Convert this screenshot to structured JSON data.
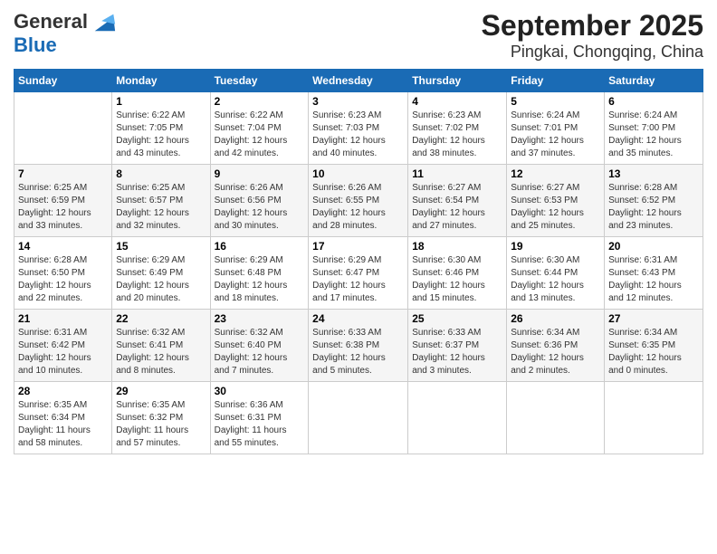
{
  "header": {
    "logo_general": "General",
    "logo_blue": "Blue",
    "title": "September 2025",
    "subtitle": "Pingkai, Chongqing, China"
  },
  "columns": [
    "Sunday",
    "Monday",
    "Tuesday",
    "Wednesday",
    "Thursday",
    "Friday",
    "Saturday"
  ],
  "weeks": [
    [
      {
        "day": "",
        "detail": ""
      },
      {
        "day": "1",
        "detail": "Sunrise: 6:22 AM\nSunset: 7:05 PM\nDaylight: 12 hours\nand 43 minutes."
      },
      {
        "day": "2",
        "detail": "Sunrise: 6:22 AM\nSunset: 7:04 PM\nDaylight: 12 hours\nand 42 minutes."
      },
      {
        "day": "3",
        "detail": "Sunrise: 6:23 AM\nSunset: 7:03 PM\nDaylight: 12 hours\nand 40 minutes."
      },
      {
        "day": "4",
        "detail": "Sunrise: 6:23 AM\nSunset: 7:02 PM\nDaylight: 12 hours\nand 38 minutes."
      },
      {
        "day": "5",
        "detail": "Sunrise: 6:24 AM\nSunset: 7:01 PM\nDaylight: 12 hours\nand 37 minutes."
      },
      {
        "day": "6",
        "detail": "Sunrise: 6:24 AM\nSunset: 7:00 PM\nDaylight: 12 hours\nand 35 minutes."
      }
    ],
    [
      {
        "day": "7",
        "detail": "Sunrise: 6:25 AM\nSunset: 6:59 PM\nDaylight: 12 hours\nand 33 minutes."
      },
      {
        "day": "8",
        "detail": "Sunrise: 6:25 AM\nSunset: 6:57 PM\nDaylight: 12 hours\nand 32 minutes."
      },
      {
        "day": "9",
        "detail": "Sunrise: 6:26 AM\nSunset: 6:56 PM\nDaylight: 12 hours\nand 30 minutes."
      },
      {
        "day": "10",
        "detail": "Sunrise: 6:26 AM\nSunset: 6:55 PM\nDaylight: 12 hours\nand 28 minutes."
      },
      {
        "day": "11",
        "detail": "Sunrise: 6:27 AM\nSunset: 6:54 PM\nDaylight: 12 hours\nand 27 minutes."
      },
      {
        "day": "12",
        "detail": "Sunrise: 6:27 AM\nSunset: 6:53 PM\nDaylight: 12 hours\nand 25 minutes."
      },
      {
        "day": "13",
        "detail": "Sunrise: 6:28 AM\nSunset: 6:52 PM\nDaylight: 12 hours\nand 23 minutes."
      }
    ],
    [
      {
        "day": "14",
        "detail": "Sunrise: 6:28 AM\nSunset: 6:50 PM\nDaylight: 12 hours\nand 22 minutes."
      },
      {
        "day": "15",
        "detail": "Sunrise: 6:29 AM\nSunset: 6:49 PM\nDaylight: 12 hours\nand 20 minutes."
      },
      {
        "day": "16",
        "detail": "Sunrise: 6:29 AM\nSunset: 6:48 PM\nDaylight: 12 hours\nand 18 minutes."
      },
      {
        "day": "17",
        "detail": "Sunrise: 6:29 AM\nSunset: 6:47 PM\nDaylight: 12 hours\nand 17 minutes."
      },
      {
        "day": "18",
        "detail": "Sunrise: 6:30 AM\nSunset: 6:46 PM\nDaylight: 12 hours\nand 15 minutes."
      },
      {
        "day": "19",
        "detail": "Sunrise: 6:30 AM\nSunset: 6:44 PM\nDaylight: 12 hours\nand 13 minutes."
      },
      {
        "day": "20",
        "detail": "Sunrise: 6:31 AM\nSunset: 6:43 PM\nDaylight: 12 hours\nand 12 minutes."
      }
    ],
    [
      {
        "day": "21",
        "detail": "Sunrise: 6:31 AM\nSunset: 6:42 PM\nDaylight: 12 hours\nand 10 minutes."
      },
      {
        "day": "22",
        "detail": "Sunrise: 6:32 AM\nSunset: 6:41 PM\nDaylight: 12 hours\nand 8 minutes."
      },
      {
        "day": "23",
        "detail": "Sunrise: 6:32 AM\nSunset: 6:40 PM\nDaylight: 12 hours\nand 7 minutes."
      },
      {
        "day": "24",
        "detail": "Sunrise: 6:33 AM\nSunset: 6:38 PM\nDaylight: 12 hours\nand 5 minutes."
      },
      {
        "day": "25",
        "detail": "Sunrise: 6:33 AM\nSunset: 6:37 PM\nDaylight: 12 hours\nand 3 minutes."
      },
      {
        "day": "26",
        "detail": "Sunrise: 6:34 AM\nSunset: 6:36 PM\nDaylight: 12 hours\nand 2 minutes."
      },
      {
        "day": "27",
        "detail": "Sunrise: 6:34 AM\nSunset: 6:35 PM\nDaylight: 12 hours\nand 0 minutes."
      }
    ],
    [
      {
        "day": "28",
        "detail": "Sunrise: 6:35 AM\nSunset: 6:34 PM\nDaylight: 11 hours\nand 58 minutes."
      },
      {
        "day": "29",
        "detail": "Sunrise: 6:35 AM\nSunset: 6:32 PM\nDaylight: 11 hours\nand 57 minutes."
      },
      {
        "day": "30",
        "detail": "Sunrise: 6:36 AM\nSunset: 6:31 PM\nDaylight: 11 hours\nand 55 minutes."
      },
      {
        "day": "",
        "detail": ""
      },
      {
        "day": "",
        "detail": ""
      },
      {
        "day": "",
        "detail": ""
      },
      {
        "day": "",
        "detail": ""
      }
    ]
  ]
}
